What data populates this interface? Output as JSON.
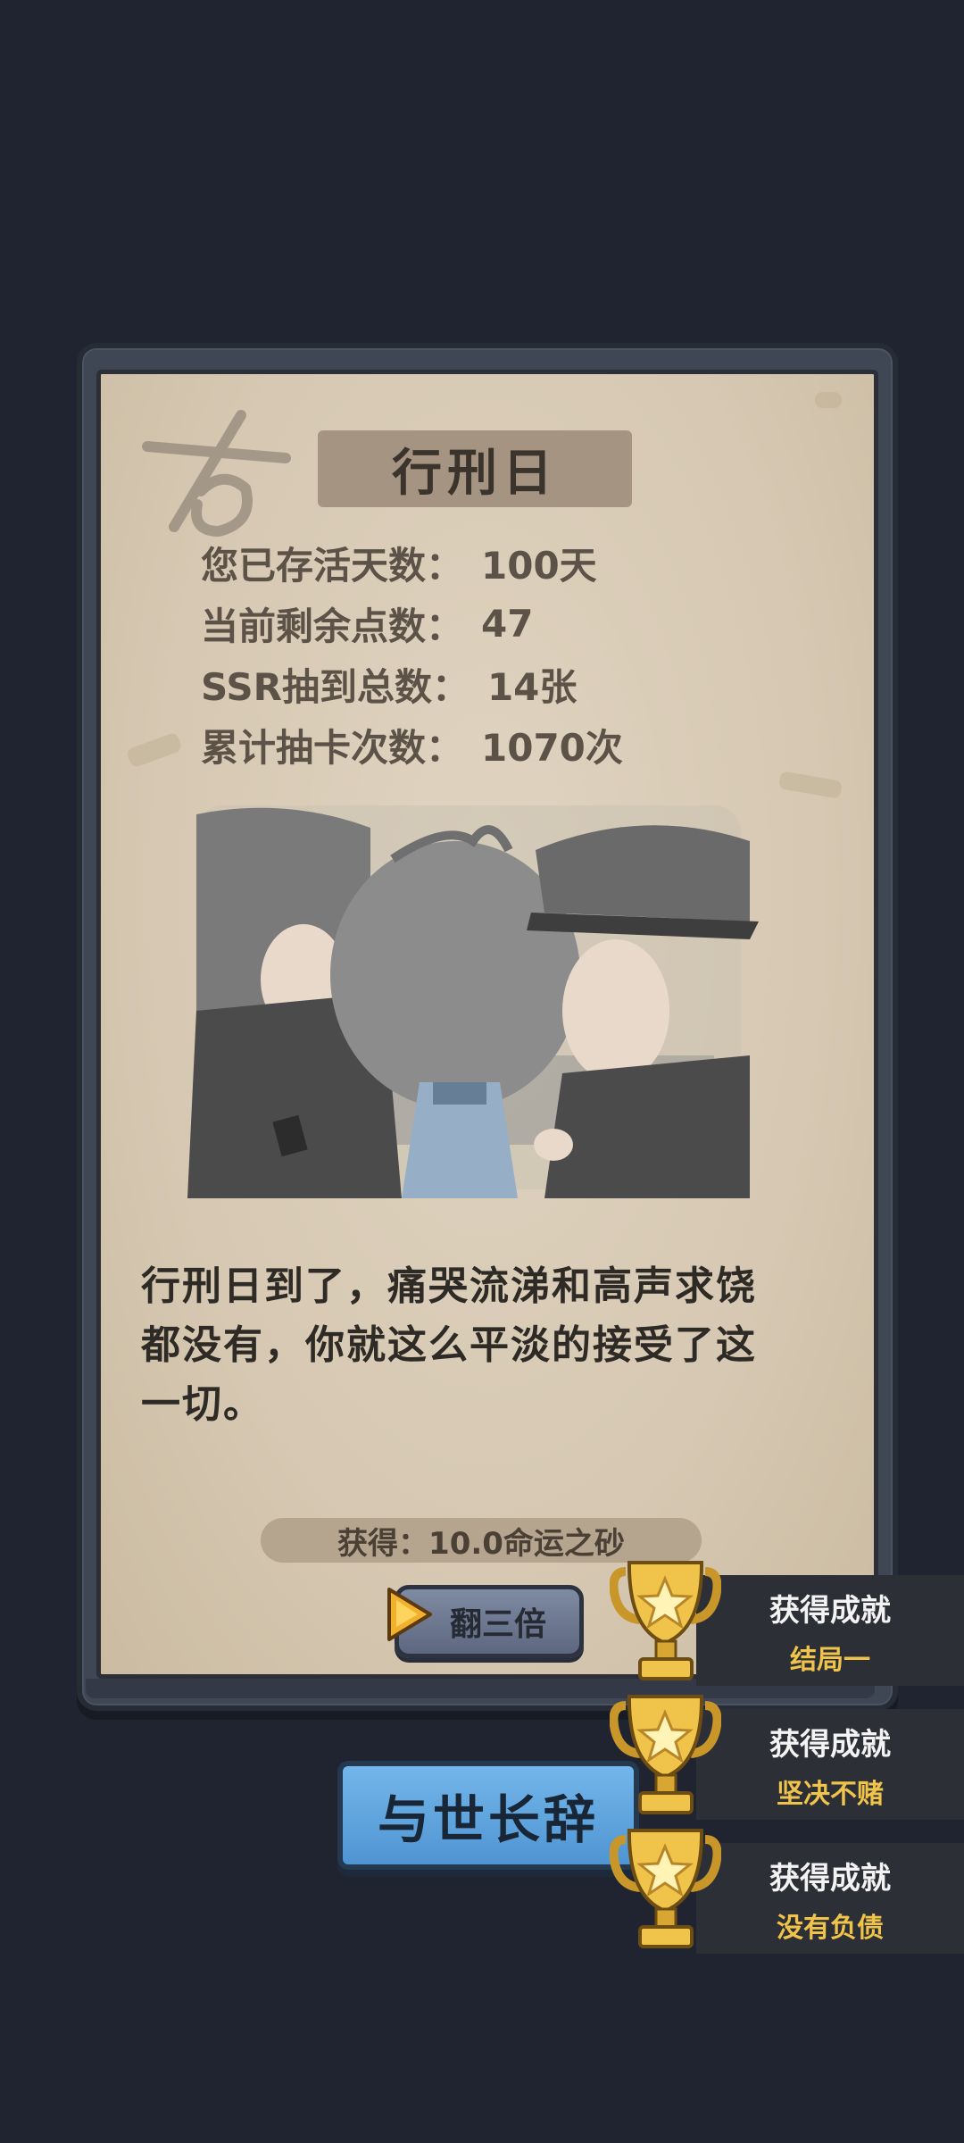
{
  "card": {
    "title": "行刑日",
    "stats": [
      {
        "label": "您已存活天数：",
        "value": "100天"
      },
      {
        "label": "当前剩余点数：",
        "value": "47"
      },
      {
        "label": "SSR抽到总数：",
        "value": "14张"
      },
      {
        "label": "累计抽卡次数：",
        "value": "1070次"
      }
    ],
    "story_lines": [
      "行刑日到了，痛哭流涕和高声求饶",
      "都没有，你就这么平淡的接受了这",
      "一切。"
    ],
    "reward": "获得：10.0命运之砂",
    "triple_button": "翻三倍"
  },
  "farewell_button": "与世长辞",
  "achievements": [
    {
      "title": "获得成就",
      "name": "结局一"
    },
    {
      "title": "获得成就",
      "name": "坚决不赌"
    },
    {
      "title": "获得成就",
      "name": "没有负债"
    }
  ],
  "colors": {
    "background": "#1f2430",
    "paper": "#d6c8b2",
    "achievement_gold": "#f0c44a",
    "button_blue": "#5fa6e0"
  }
}
